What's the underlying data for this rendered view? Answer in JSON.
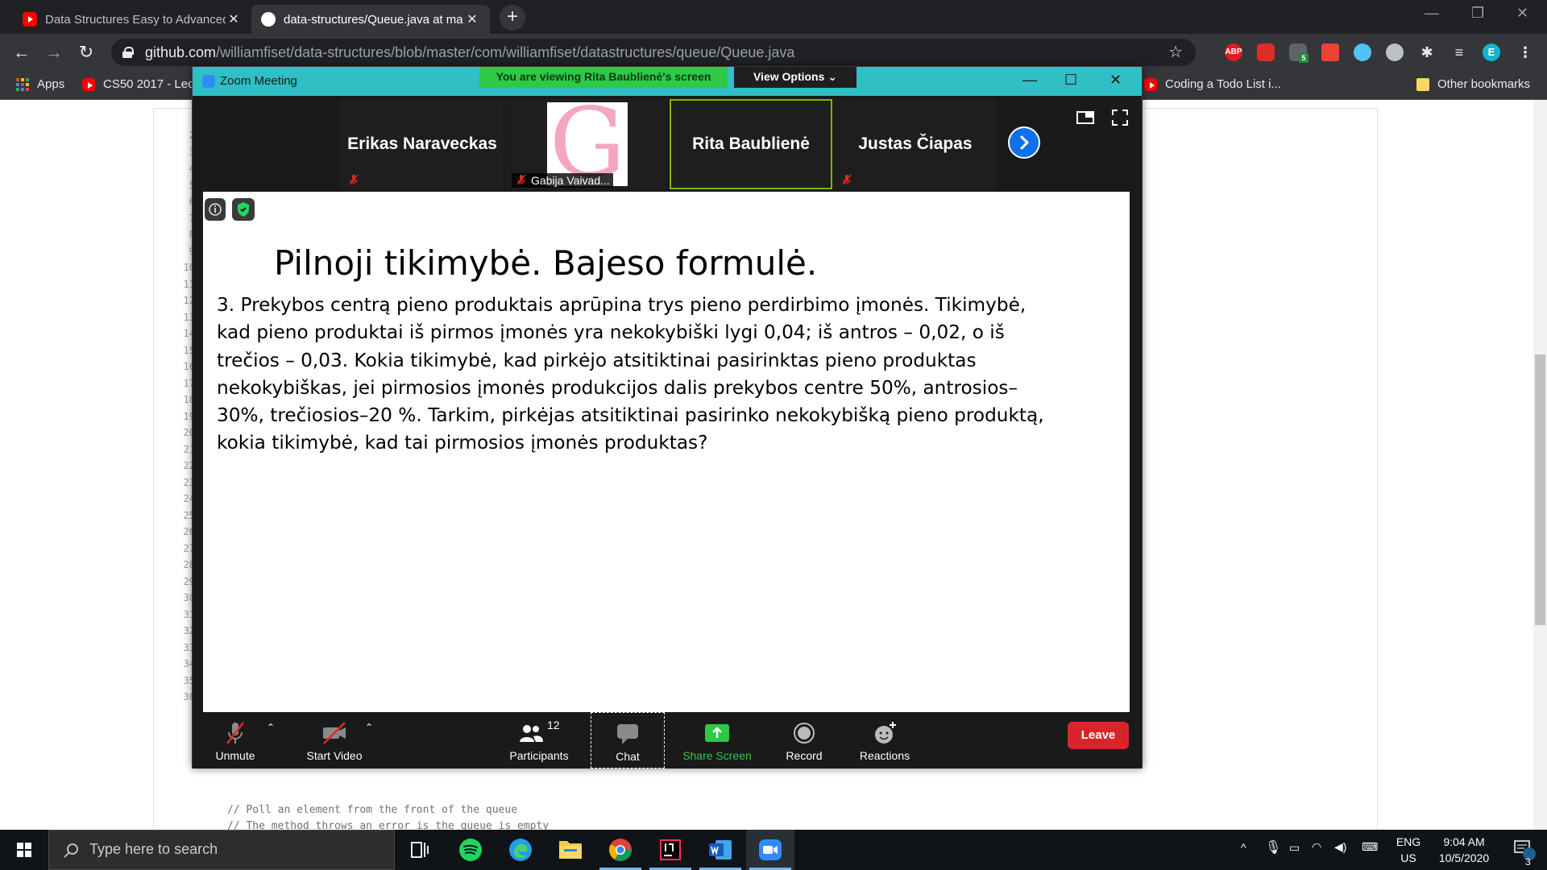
{
  "browser": {
    "tabs": [
      {
        "title": "Data Structures Easy to Advanced",
        "favicon": "youtube-icon",
        "active": false
      },
      {
        "title": "data-structures/Queue.java at ma",
        "favicon": "github-icon",
        "active": true
      }
    ],
    "url": {
      "host": "github.com",
      "path": "/williamfiset/data-structures/blob/master/com/williamfiset/datastructures/queue/Queue.java"
    },
    "extensions": [
      "ABP",
      "E"
    ],
    "extension_badge": "5",
    "bookmarks": [
      {
        "label": "Apps",
        "icon": "apps-grid-icon"
      },
      {
        "label": "CS50 2017 - Lec",
        "icon": "youtube-icon"
      },
      {
        "label": "Coding a Todo List i...",
        "icon": "youtube-icon"
      },
      {
        "label": "Other bookmarks",
        "icon": "folder-icon"
      }
    ]
  },
  "code": {
    "line_numbers": [
      "2",
      "3",
      "4",
      "5",
      "6",
      "7",
      "8",
      "9",
      "10",
      "11",
      "12",
      "13",
      "14",
      "15",
      "16",
      "17",
      "18",
      "19",
      "20",
      "21",
      "22",
      "23",
      "24",
      "25",
      "26",
      "27",
      "28",
      "29",
      "30",
      "31",
      "32",
      "33",
      "34",
      "35",
      "36"
    ],
    "lines": [
      {
        "no": "34",
        "text": ""
      },
      {
        "no": "35",
        "text": "// Poll an element from the front of the queue"
      },
      {
        "no": "36",
        "text": "// The method throws an error is the queue is empty"
      }
    ]
  },
  "zoom": {
    "window_title": "Zoom Meeting",
    "viewing_banner": "You are viewing Rita Baublienė's screen",
    "view_options": "View Options",
    "participants": [
      {
        "name": "Erikas Naraveckas",
        "muted": true,
        "has_image": false
      },
      {
        "name": "Gabija Vaivad...",
        "muted": true,
        "has_image": true,
        "image_letter": "G"
      },
      {
        "name": "Rita Baublienė",
        "muted": false,
        "has_image": false,
        "speaking": true
      },
      {
        "name": "Justas Čiapas",
        "muted": true,
        "has_image": false
      }
    ],
    "slide": {
      "title": "Pilnoji tikimybė. Bajeso formulė.",
      "lines": [
        "3. Prekybos centrą pieno produktais aprūpina trys pieno perdirbimo įmonės. Tikimybė,",
        "kad pieno produktai iš pirmos įmonės yra nekokybiški lygi 0,04; iš antros – 0,02, o iš",
        "trečios – 0,03. Kokia tikimybė, kad pirkėjo atsitiktinai pasirinktas pieno produktas",
        "nekokybiškas, jei pirmosios įmonės produkcijos  dalis prekybos centre 50%, antrosios–",
        "30%, trečiosios–20 %. Tarkim, pirkėjas atsitiktinai pasirinko nekokybišką pieno produktą,",
        "kokia tikimybė, kad tai pirmosios įmonės produktas?"
      ]
    },
    "controls": {
      "unmute": "Unmute",
      "start_video": "Start Video",
      "participants": "Participants",
      "participants_count": "12",
      "chat": "Chat",
      "share_screen": "Share Screen",
      "record": "Record",
      "reactions": "Reactions",
      "leave": "Leave"
    }
  },
  "taskbar": {
    "search_placeholder": "Type here to search",
    "apps": [
      "task-view-icon",
      "spotify-icon",
      "edge-icon",
      "file-explorer-icon",
      "chrome-icon",
      "intellij-icon",
      "word-icon",
      "zoom-icon"
    ],
    "language": "ENG",
    "region": "US",
    "time": "9:04 AM",
    "date": "10/5/2020",
    "notifications": "3"
  },
  "colors": {
    "chrome_dark": "#202124",
    "zoom_titlebar": "#2fbfc4",
    "zoom_banner_green": "#2ec946",
    "zoom_leave_red": "#d7262b",
    "zoom_share_green": "#2ec946",
    "speaking_border": "#7fb800"
  }
}
